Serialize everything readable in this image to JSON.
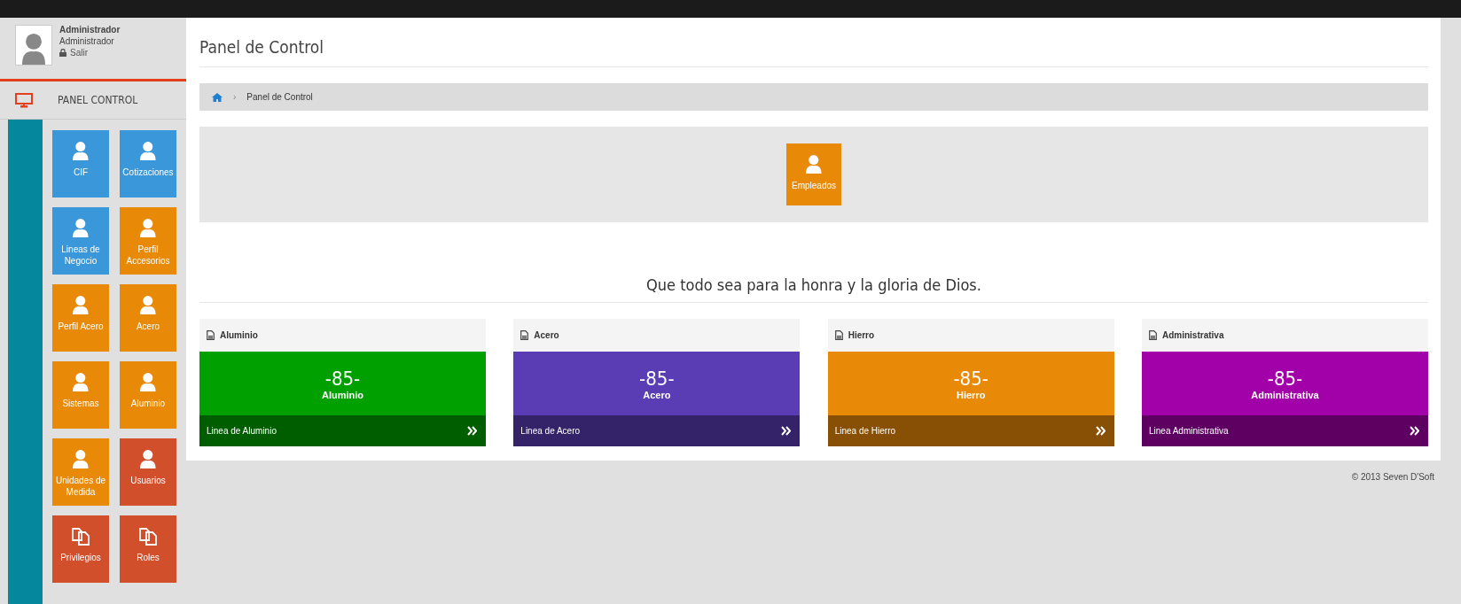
{
  "user": {
    "name": "Administrador",
    "role": "Administrador",
    "logout": "Salir"
  },
  "nav": {
    "label": "PANEL CONTROL"
  },
  "tiles": [
    {
      "label": "CIF",
      "kind": "user",
      "color": "#3a97d9"
    },
    {
      "label": "Cotizaciones",
      "kind": "user",
      "color": "#3a97d9"
    },
    {
      "label": "Lineas de Negocio",
      "kind": "user",
      "color": "#3a97d9"
    },
    {
      "label": "Perfil Accesorios",
      "kind": "user",
      "color": "#e88a07"
    },
    {
      "label": "Perfil Acero",
      "kind": "user",
      "color": "#e88a07"
    },
    {
      "label": "Acero",
      "kind": "user",
      "color": "#e88a07"
    },
    {
      "label": "Sistemas",
      "kind": "user",
      "color": "#e88a07"
    },
    {
      "label": "Aluminio",
      "kind": "user",
      "color": "#e88a07"
    },
    {
      "label": "Unidades de Medida",
      "kind": "user",
      "color": "#e88a07"
    },
    {
      "label": "Usuarios",
      "kind": "user",
      "color": "#d14f2b"
    },
    {
      "label": "Privilegios",
      "kind": "docs",
      "color": "#d14f2b"
    },
    {
      "label": "Roles",
      "kind": "docs",
      "color": "#d14f2b"
    }
  ],
  "page_title": "Panel de Control",
  "breadcrumb_separator": "›",
  "breadcrumb": [
    "Panel de Control"
  ],
  "featured": {
    "label": "Empleados",
    "kind": "user",
    "color": "#e88a07"
  },
  "quote": "Que todo sea para la honra y la gloria de Dios.",
  "cards": [
    {
      "title": "Aluminio",
      "value": "-85-",
      "caption": "Aluminio",
      "link": "Linea de Aluminio",
      "color": "#00a000"
    },
    {
      "title": "Acero",
      "value": "-85-",
      "caption": "Acero",
      "link": "Linea de Acero",
      "color": "#5a3cb4"
    },
    {
      "title": "Hierro",
      "value": "-85-",
      "caption": "Hierro",
      "link": "Linea de Hierro",
      "color": "#e88a07"
    },
    {
      "title": "Administrativa",
      "value": "-85-",
      "caption": "Administrativa",
      "link": "Linea Administrativa",
      "color": "#a200a8"
    }
  ],
  "footer": "© 2013 Seven D'Soft"
}
